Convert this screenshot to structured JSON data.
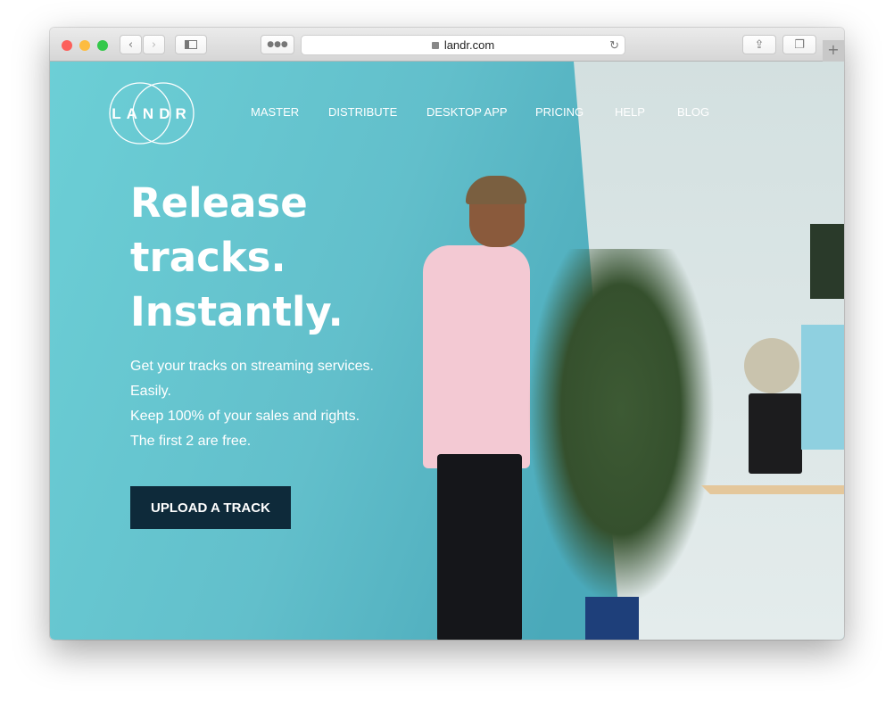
{
  "browser": {
    "url": "landr.com",
    "colors": {
      "close": "#fc605b",
      "minimize": "#fdbc40",
      "zoom": "#34c84a"
    }
  },
  "nav": {
    "logo": "LANDR",
    "items": [
      "MASTER",
      "DISTRIBUTE",
      "DESKTOP APP",
      "PRICING",
      "HELP",
      "BLOG"
    ]
  },
  "hero": {
    "title_lines": [
      "Release",
      "tracks.",
      "Instantly."
    ],
    "subtitle_lines": [
      "Get your tracks on streaming services.",
      "Easily.",
      "Keep 100% of your sales and rights.",
      "The first 2 are free."
    ],
    "cta": "UPLOAD A TRACK"
  },
  "colors": {
    "accent": "#62bfcb",
    "cta_bg": "#0e2a3a"
  }
}
